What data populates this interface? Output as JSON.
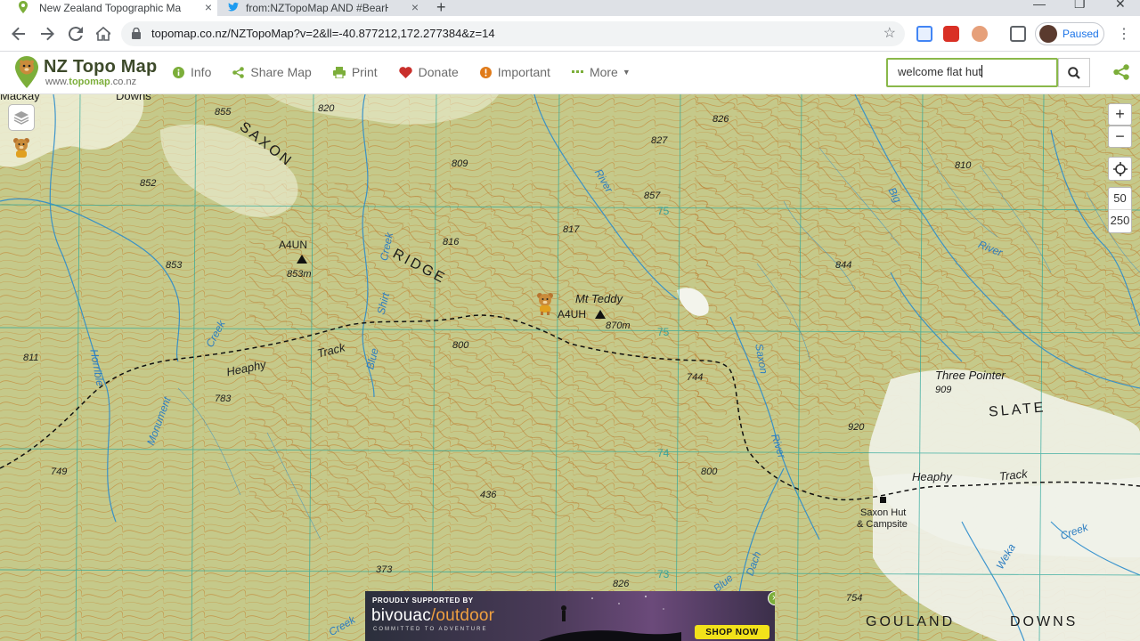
{
  "browser": {
    "tabs": [
      {
        "title": "New Zealand Topographic Map -",
        "active": true
      },
      {
        "title": "from:NZTopoMap AND #BearHu",
        "active": false
      }
    ],
    "new_tab": "+",
    "url": "topomap.co.nz/NZTopoMap?v=2&ll=-40.877212,172.277384&z=14",
    "profile_status": "Paused"
  },
  "site": {
    "logo_title": "NZ Topo Map",
    "logo_sub_prefix": "www.",
    "logo_sub_brand": "topomap",
    "logo_sub_suffix": ".co.nz",
    "menu": [
      {
        "label": "Info",
        "icon": "info-circle-icon"
      },
      {
        "label": "Share Map",
        "icon": "share-icon"
      },
      {
        "label": "Print",
        "icon": "print-icon"
      },
      {
        "label": "Donate",
        "icon": "heart-icon"
      },
      {
        "label": "Important",
        "icon": "alert-icon"
      },
      {
        "label": "More",
        "icon": "dots-icon"
      }
    ],
    "search_value": "welcome flat hut"
  },
  "map": {
    "zoom_in": "+",
    "zoom_out": "−",
    "scale_top": "50",
    "scale_bottom": "250",
    "labels": {
      "saxon": "SAXON",
      "ridge": "RIDGE",
      "slate": "SLATE",
      "gouland": "GOULAND",
      "downs": "DOWNS",
      "mackay": "Mackay",
      "downs_top": "Downs",
      "a4un": "A4UN",
      "a4un_h": "853m",
      "a4uh": "A4UH",
      "mt_teddy": "Mt Teddy",
      "mt_teddy_h": "870m",
      "three_pointer": "Three Pointer",
      "saxon_hut": "Saxon Hut",
      "campsite": "& Campsite",
      "heaphy1": "Heaphy",
      "track1": "Track",
      "heaphy2": "Heaphy",
      "track2": "Track",
      "river_big": "Big",
      "river_river": "River",
      "river_saxon": "Saxon",
      "river_river2": "River",
      "river_river3": "River",
      "creek_horrible": "Horrible",
      "creek_monument": "Monument",
      "creek_creek1": "Creek",
      "creek_creek2": "Creek",
      "creek_blue": "Blue",
      "creek_shirt": "Shirt",
      "creek_creek3": "Creek",
      "creek_weka": "Weka",
      "creek_dach": "Dach",
      "creek_blue2": "Blue",
      "creek_creek4": "Creek",
      "e855": "855",
      "e820": "820",
      "e809": "809",
      "e852": "852",
      "e853": "853",
      "e811": "811",
      "e816": "816",
      "e817": "817",
      "e800": "800",
      "e783": "783",
      "e749": "749",
      "e436": "436",
      "e373": "373",
      "e826": "826",
      "e827": "827",
      "e857": "857",
      "e744": "744",
      "e800b": "800",
      "e826b": "826",
      "e810": "810",
      "e844": "844",
      "e909": "909",
      "e920": "920",
      "e754": "754",
      "g75": "75",
      "g75b": "75",
      "g74": "74",
      "g73": "73"
    }
  },
  "ad": {
    "supported": "PROUDLY SUPPORTED BY",
    "brand_a": "bivouac",
    "brand_b": "/outdoor",
    "tagline": "COMMITTED TO ADVENTURE",
    "cta": "SHOP NOW",
    "close": "×"
  }
}
